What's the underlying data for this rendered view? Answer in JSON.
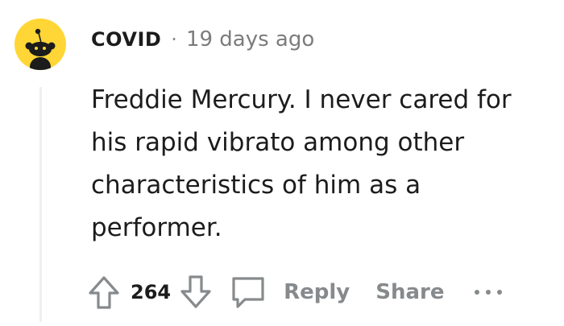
{
  "comment": {
    "username": "COVID",
    "separator": "·",
    "timestamp": "19 days ago",
    "body": "Freddie Mercury. I never cared for his rapid vibrato among other characteristics of him as a performer.",
    "score": "264"
  },
  "actions": {
    "reply_label": "Reply",
    "share_label": "Share",
    "more_label": "•••"
  },
  "icons": {
    "avatar": "reddit-snoo-avatar",
    "upvote": "arrow-up-icon",
    "downvote": "arrow-down-icon",
    "comment": "speech-bubble-icon",
    "more": "ellipsis-icon"
  },
  "colors": {
    "avatar_bg": "#ffd635",
    "text": "#1c1c1c",
    "meta": "#878a8c",
    "thread_line": "#edeff1"
  }
}
